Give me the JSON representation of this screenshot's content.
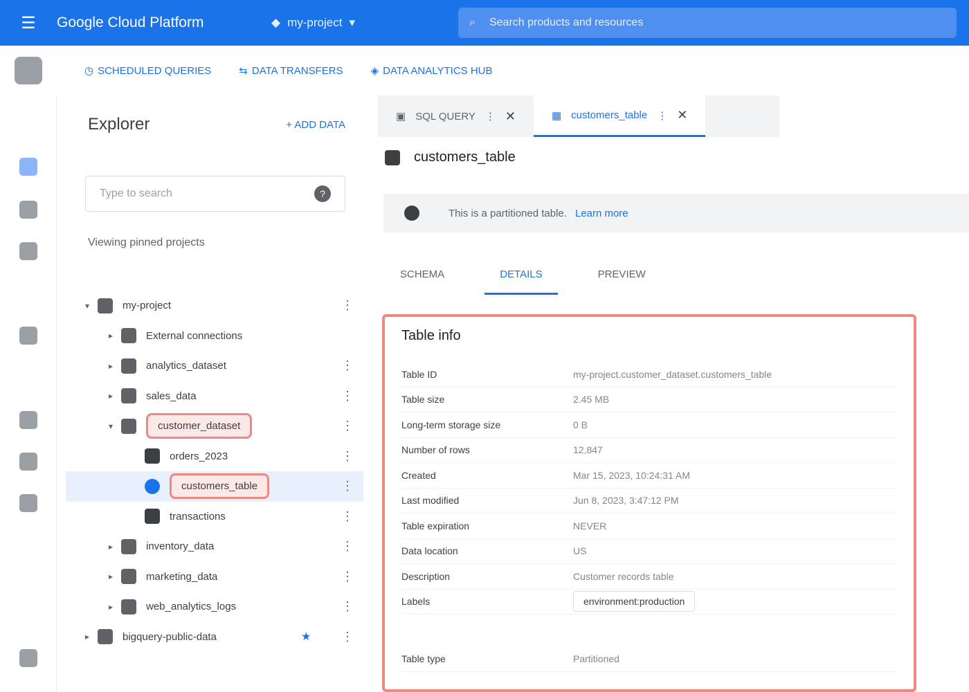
{
  "topbar": {
    "brand": "Google Cloud Platform",
    "project": "my-project",
    "search_placeholder": "Search products and resources"
  },
  "subbar": {
    "links": [
      "SCHEDULED QUERIES",
      "DATA TRANSFERS",
      "DATA ANALYTICS HUB"
    ]
  },
  "explorer": {
    "title": "Explorer",
    "add_label": "+ ADD DATA",
    "search_placeholder": "Type to search",
    "toggle_label": "Viewing pinned projects",
    "tree": [
      {
        "label": "my-project",
        "level": 0,
        "arrow": "▾",
        "kebab": true,
        "star": false
      },
      {
        "label": "External connections",
        "level": 1,
        "arrow": "▸",
        "kebab": false,
        "star": false
      },
      {
        "label": "analytics_dataset",
        "level": 1,
        "arrow": "▸",
        "kebab": true,
        "star": false
      },
      {
        "label": "sales_data",
        "level": 1,
        "arrow": "▸",
        "kebab": true,
        "star": false
      },
      {
        "label": "customer_dataset",
        "level": 1,
        "arrow": "▾",
        "kebab": true,
        "star": false,
        "highlight": true
      },
      {
        "label": "orders_2023",
        "level": 2,
        "arrow": "",
        "kebab": true,
        "star": false
      },
      {
        "label": "customers_table",
        "level": 2,
        "arrow": "",
        "kebab": true,
        "star": false,
        "highlight": true,
        "selected": true
      },
      {
        "label": "transactions",
        "level": 2,
        "arrow": "",
        "kebab": true,
        "star": false
      },
      {
        "label": "inventory_data",
        "level": 1,
        "arrow": "▸",
        "kebab": true,
        "star": false
      },
      {
        "label": "marketing_data",
        "level": 1,
        "arrow": "▸",
        "kebab": true,
        "star": false
      },
      {
        "label": "web_analytics_logs",
        "level": 1,
        "arrow": "▸",
        "kebab": true,
        "star": false
      },
      {
        "label": "bigquery-public-data",
        "level": 0,
        "arrow": "▸",
        "kebab": true,
        "star": true
      }
    ]
  },
  "tabs": [
    {
      "label": "SQL QUERY",
      "active": false
    },
    {
      "label": "customers_table",
      "active": true
    }
  ],
  "main": {
    "title": "customers_table",
    "banner_text": "This is a partitioned table.",
    "banner_link": "Learn more",
    "subtabs": [
      "SCHEMA",
      "DETAILS",
      "PREVIEW"
    ],
    "active_subtab": 1
  },
  "table_info": {
    "heading": "Table info",
    "rows": [
      {
        "key": "Table ID",
        "value": "my-project.customer_dataset.customers_table"
      },
      {
        "key": "Table size",
        "value": "2.45 MB"
      },
      {
        "key": "Long-term storage size",
        "value": "0 B"
      },
      {
        "key": "Number of rows",
        "value": "12,847"
      },
      {
        "key": "Created",
        "value": "Mar 15, 2023, 10:24:31 AM"
      },
      {
        "key": "Last modified",
        "value": "Jun 8, 2023, 3:47:12 PM"
      },
      {
        "key": "Table expiration",
        "value": "NEVER"
      },
      {
        "key": "Data location",
        "value": "US"
      },
      {
        "key": "Description",
        "value": "Customer records table"
      },
      {
        "key": "Labels",
        "value": "environment:production",
        "button": true
      }
    ],
    "footer_row": {
      "key": "Table type",
      "value": "Partitioned"
    }
  }
}
